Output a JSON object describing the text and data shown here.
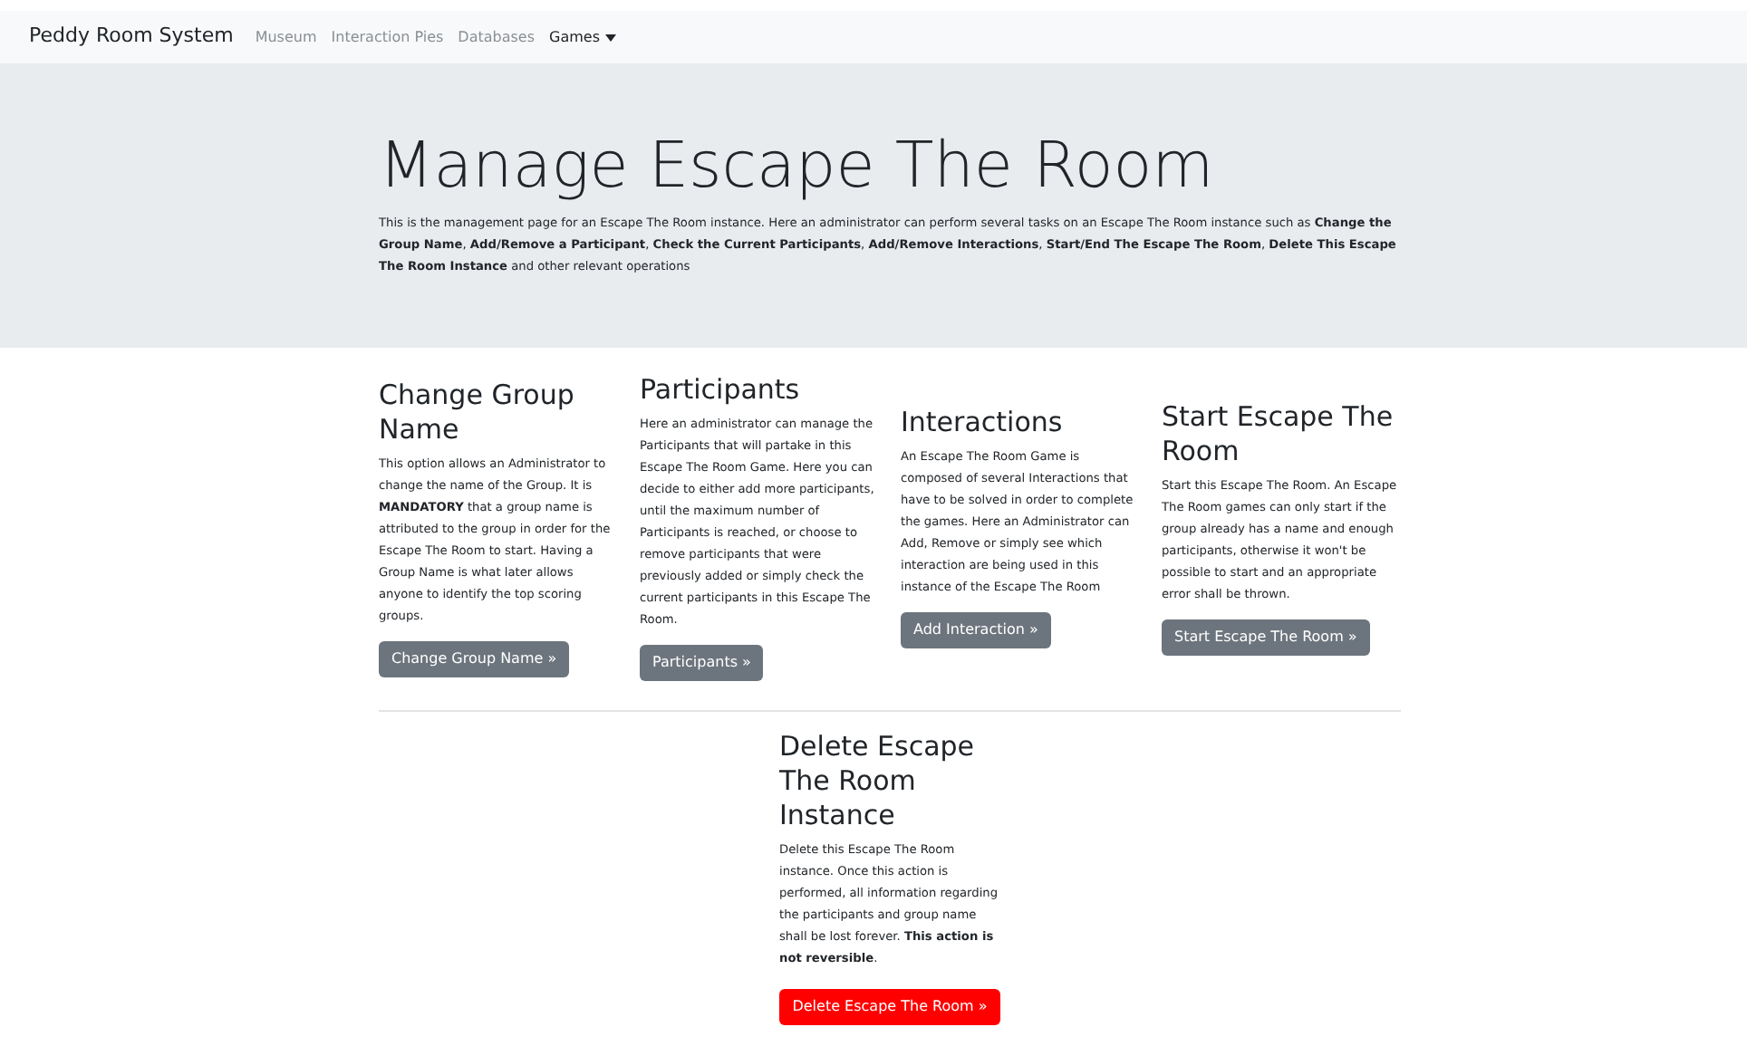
{
  "navbar": {
    "brand": "Peddy Room System",
    "links": [
      {
        "label": "Museum",
        "active": false,
        "dropdown": false
      },
      {
        "label": "Interaction Pies",
        "active": false,
        "dropdown": false
      },
      {
        "label": "Databases",
        "active": false,
        "dropdown": false
      },
      {
        "label": "Games",
        "active": true,
        "dropdown": true
      }
    ]
  },
  "jumbotron": {
    "title": "Manage Escape The Room",
    "text": "This is the management page for an Escape The Room instance. Here an administrator can perform several tasks on an Escape The Room instance such as **Change the Group Name**, **Add/Remove a Participant**, **Check the Current Participants**, **Add/Remove Interactions**, **Start/End The Escape The Room**, **Delete This Escape The Room Instance** and other relevant operations"
  },
  "sections": [
    {
      "heading": "Change Group Name",
      "text": "This option allows an Administrator to change the name of the Group. It is **MANDATORY** that a group name is attributed to the group in order for the Escape The Room to start. Having a Group Name is what later allows anyone to identify the top scoring groups.",
      "button": {
        "label": "Change Group Name »",
        "kind": "secondary"
      }
    },
    {
      "heading": "Participants",
      "text": "Here an administrator can manage the Participants that will partake in this Escape The Room Game. Here you can decide to either add more participants, until the maximum number of Participants is reached, or choose to remove participants that were previously added or simply check the current participants in this Escape The Room.",
      "button": {
        "label": "Participants »",
        "kind": "secondary"
      }
    },
    {
      "heading": "Interactions",
      "text": "An Escape The Room Game is composed of several Interactions that have to be solved in order to complete the games. Here an Administrator can Add, Remove or simply see which interaction are being used in this instance of the Escape The Room",
      "button": {
        "label": "Add Interaction »",
        "kind": "secondary"
      }
    },
    {
      "heading": "Start Escape The Room",
      "text": "Start this Escape The Room. An Escape The Room games can only start if the group already has a name and enough participants, otherwise it won't be possible to start and an appropriate error shall be thrown.",
      "button": {
        "label": "Start Escape The Room »",
        "kind": "secondary"
      }
    }
  ],
  "delete_section": {
    "heading": "Delete Escape The Room Instance",
    "text": "Delete this Escape The Room instance. Once this action is performed, all information regarding the participants and group name shall be lost forever. **This action is not reversible**.",
    "button": {
      "label": "Delete Escape The Room »",
      "kind": "danger"
    }
  }
}
